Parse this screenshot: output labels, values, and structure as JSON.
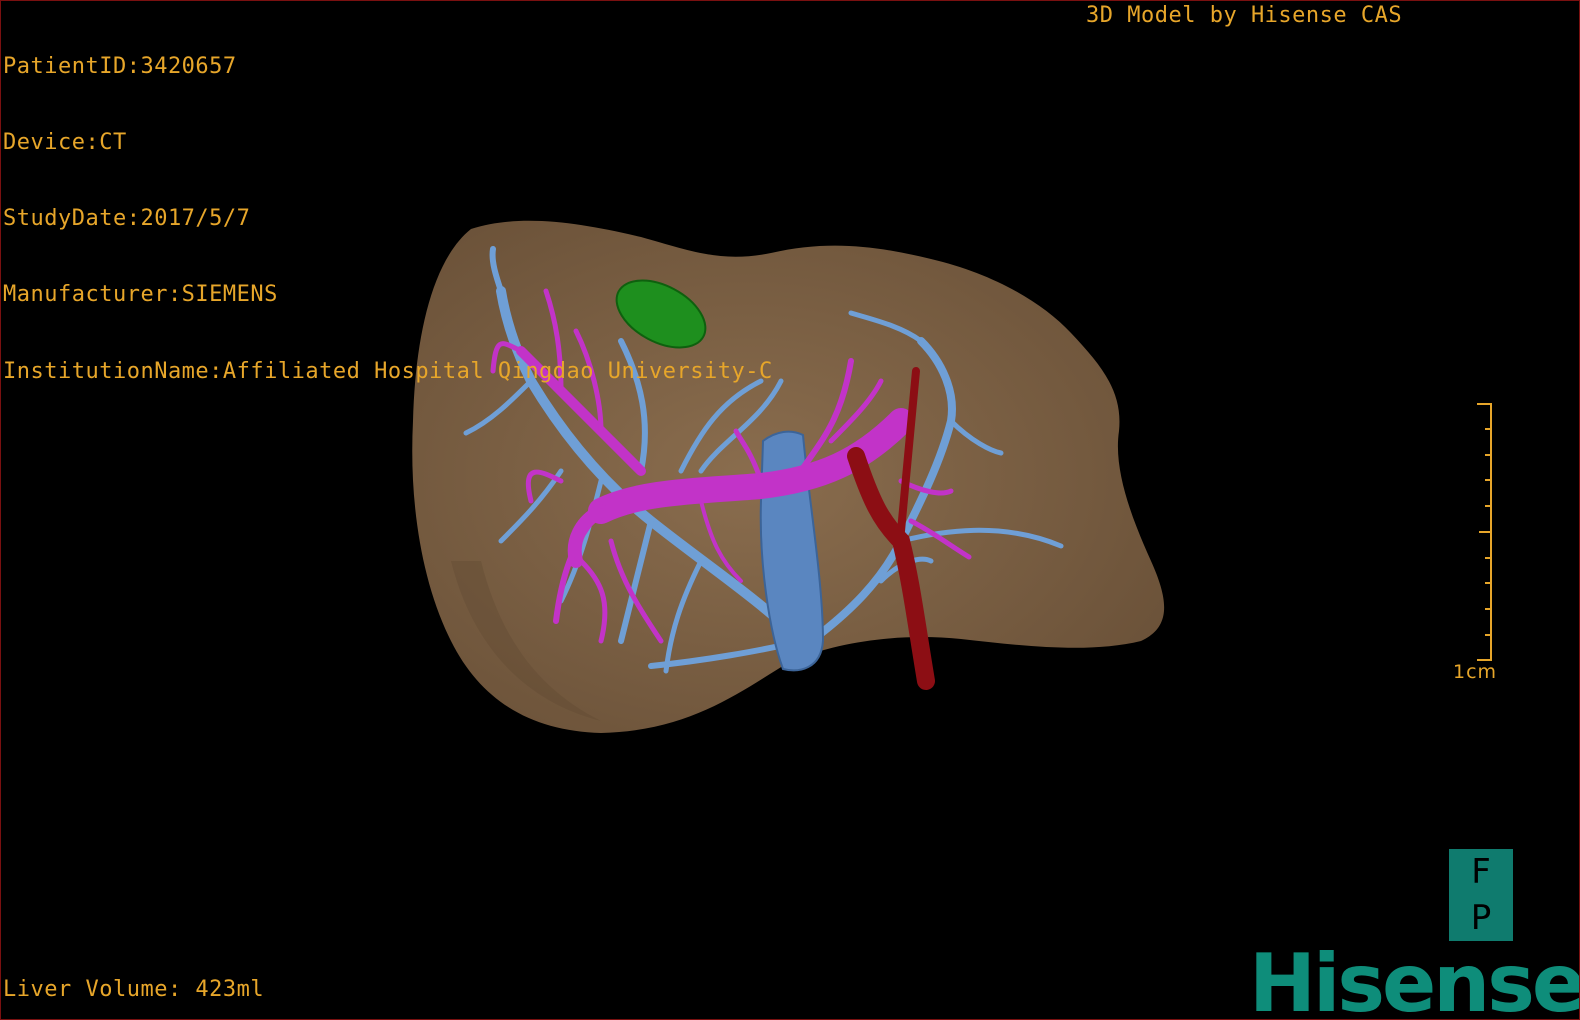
{
  "header": {
    "patient_id": "PatientID:3420657",
    "device": "Device:CT",
    "study_date": "StudyDate:2017/5/7",
    "manufacturer": "Manufacturer:SIEMENS",
    "institution": "InstitutionName:Affiliated Hospital Qingdao University-C"
  },
  "brand_text": "3D Model by Hisense CAS",
  "liver_volume": "Liver Volume: 423ml",
  "scale_label": "1cm",
  "orientation": {
    "top": "F",
    "bottom": "P"
  },
  "logo_text": "Hisense",
  "colors": {
    "overlay_text": "#e7a62a",
    "liver": "#7b6246",
    "portal_vein": "#c233c8",
    "hepatic_vein": "#6f9fd6",
    "vena_cava": "#5a86c0",
    "artery": "#8c0e14",
    "gallbladder": "#1e8f1e",
    "brand": "#0e8d7a"
  }
}
